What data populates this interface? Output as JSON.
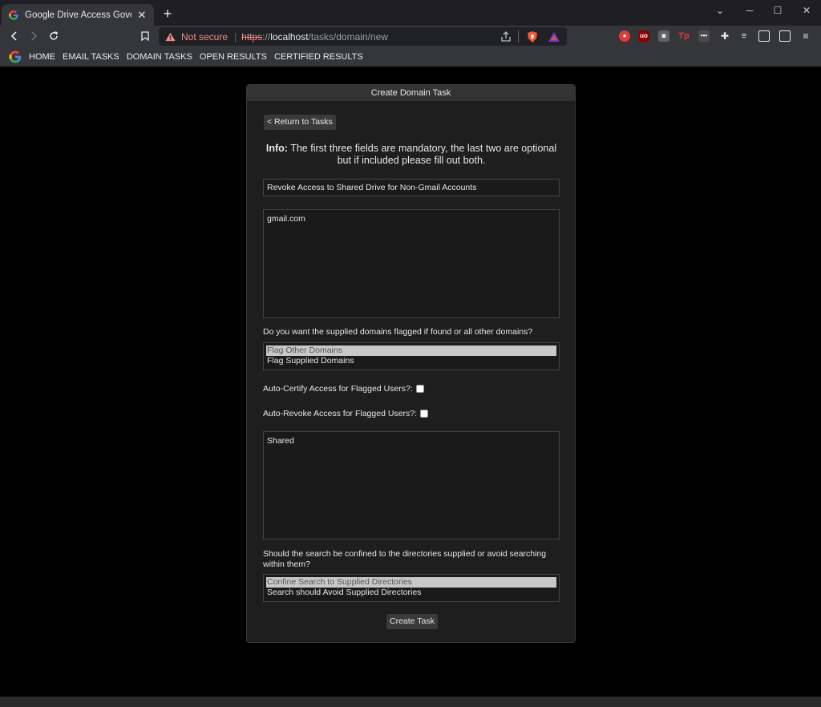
{
  "tab": {
    "title": "Google Drive Access Governance",
    "close": "✕"
  },
  "new_tab": "+",
  "window": {
    "minimize": "─",
    "maximize": "☐",
    "close": "✕",
    "collapse": "⌄"
  },
  "address": {
    "security_label": "Not secure",
    "scheme": "https",
    "sep": "://",
    "host": "localhost",
    "path": "/tasks/domain/new"
  },
  "bookmarks": [
    "HOME",
    "EMAIL TASKS",
    "DOMAIN TASKS",
    "OPEN RESULTS",
    "CERTIFIED RESULTS"
  ],
  "card": {
    "header": "Create Domain Task",
    "back_label": "< Return to Tasks",
    "info_bold": "Info:",
    "info_text": " The first three fields are mandatory, the last two are optional but if included please fill out both.",
    "task_name": "Revoke Access to Shared Drive for Non-Gmail Accounts",
    "domains": "gmail.com",
    "flag_question": "Do you want the supplied domains flagged if found or all other domains?",
    "flag_options": [
      "Flag Other Domains",
      "Flag Supplied Domains"
    ],
    "auto_certify_label": "Auto-Certify Access for Flagged Users?:",
    "auto_revoke_label": "Auto-Revoke Access for Flagged Users?:",
    "directories": "Shared",
    "search_question": "Should the search be confined to the directories supplied or avoid searching within them?",
    "search_options": [
      "Confine Search to Supplied Directories",
      "Search should Avoid Supplied Directories"
    ],
    "submit_label": "Create Task"
  },
  "colors": {
    "background": "#000000",
    "card": "#1e1e1e",
    "accent_warning": "#f28b82"
  }
}
